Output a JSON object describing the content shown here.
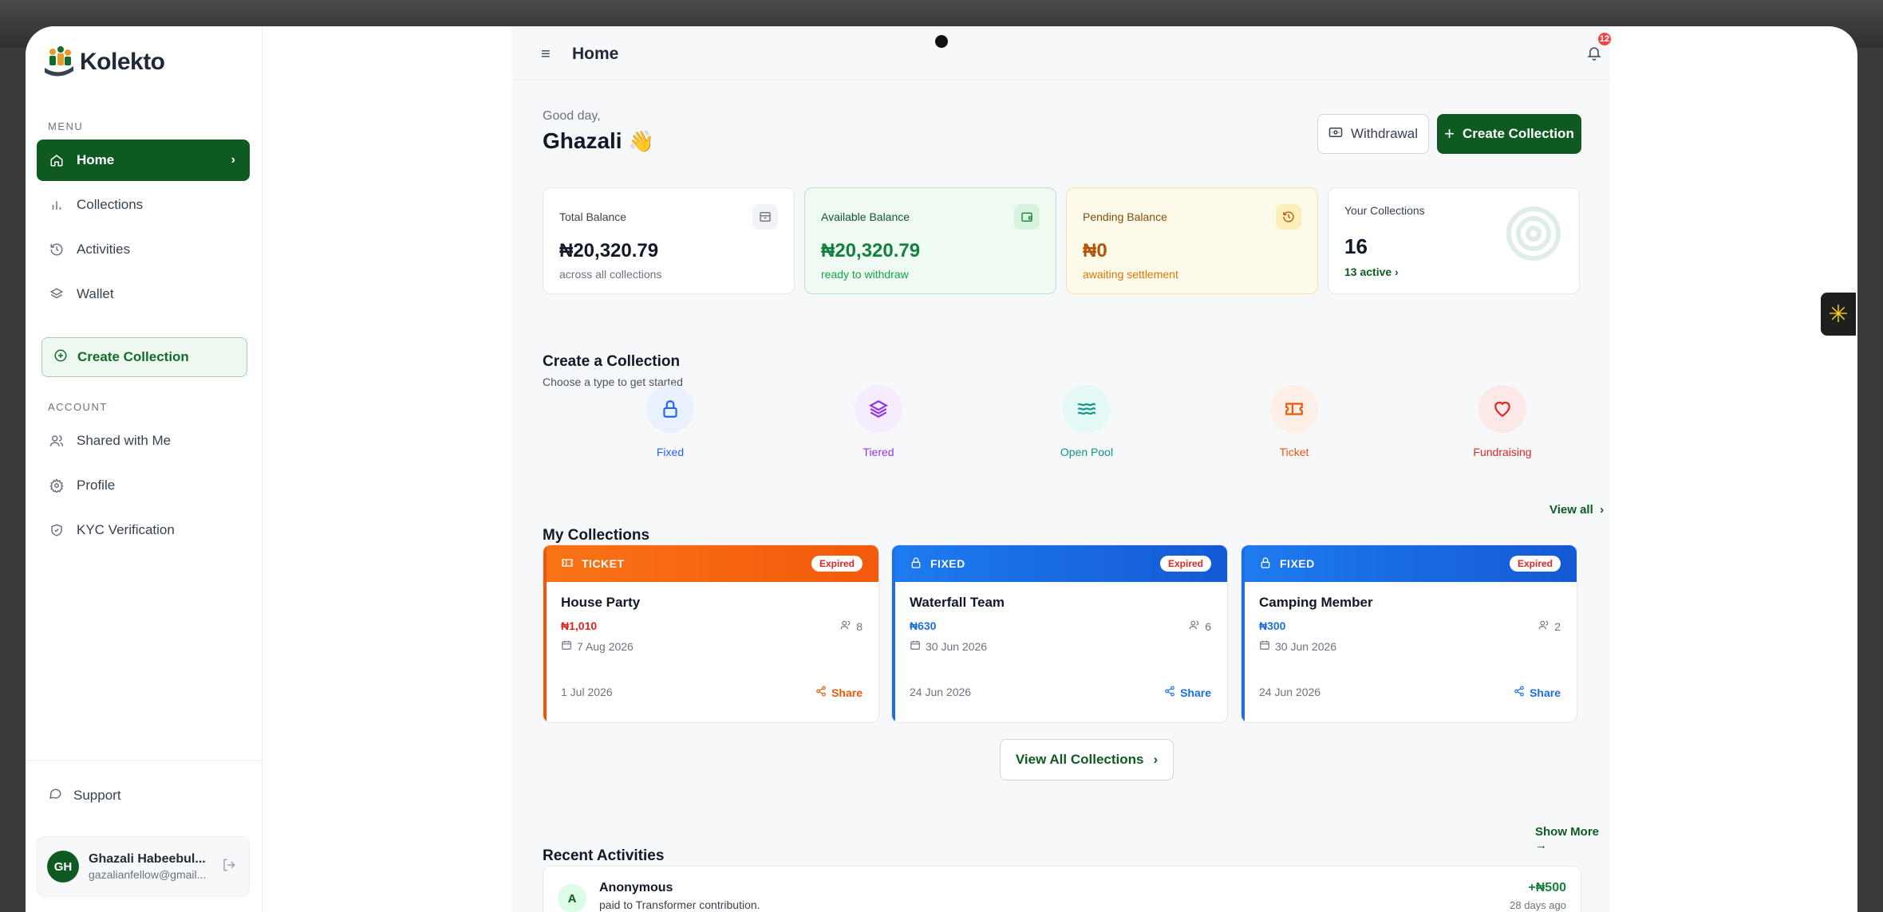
{
  "app": {
    "name": "Kolekto"
  },
  "sidebar": {
    "menu_label": "MENU",
    "account_label": "ACCOUNT",
    "menu_items": [
      {
        "label": "Home",
        "icon": "home-icon"
      },
      {
        "label": "Collections",
        "icon": "bar-chart-icon"
      },
      {
        "label": "Activities",
        "icon": "history-icon"
      },
      {
        "label": "Wallet",
        "icon": "layers-icon"
      }
    ],
    "create_label": "Create Collection",
    "account_items": [
      {
        "label": "Shared with Me",
        "icon": "users-icon"
      },
      {
        "label": "Profile",
        "icon": "gear-icon"
      },
      {
        "label": "KYC Verification",
        "icon": "shield-check-icon"
      }
    ],
    "support_label": "Support",
    "user": {
      "initials": "GH",
      "name": "Ghazali Habeebul...",
      "email": "gazalianfellow@gmail..."
    }
  },
  "topbar": {
    "title": "Home",
    "notification_count": "12"
  },
  "header": {
    "greeting": "Good day,",
    "name": "Ghazali",
    "wave": "👋",
    "withdraw_label": "Withdrawal",
    "create_label": "Create Collection"
  },
  "stats": {
    "total": {
      "label": "Total Balance",
      "value": "₦20,320.79",
      "sub": "across all collections"
    },
    "available": {
      "label": "Available Balance",
      "value": "₦20,320.79",
      "sub": "ready to withdraw"
    },
    "pending": {
      "label": "Pending Balance",
      "value": "₦0",
      "sub": "awaiting settlement"
    },
    "collections": {
      "label": "Your Collections",
      "value": "16",
      "sub": "13 active"
    }
  },
  "create_section": {
    "title": "Create a Collection",
    "subtitle": "Choose a type to get started",
    "types": [
      {
        "label": "Fixed",
        "icon": "lock-icon",
        "color": "#2563eb",
        "bg": "#e8f1fd"
      },
      {
        "label": "Tiered",
        "icon": "layers-icon",
        "color": "#9333ea",
        "bg": "#f5ecfd"
      },
      {
        "label": "Open Pool",
        "icon": "waves-icon",
        "color": "#0d9488",
        "bg": "#e4f8f6"
      },
      {
        "label": "Ticket",
        "icon": "ticket-icon",
        "color": "#ea580c",
        "bg": "#fdefe5"
      },
      {
        "label": "Fundraising",
        "icon": "heart-icon",
        "color": "#dc2626",
        "bg": "#fde8e8"
      }
    ]
  },
  "my_collections": {
    "title": "My Collections",
    "view_all": "View all",
    "items": [
      {
        "type": "TICKET",
        "status": "Expired",
        "title": "House Party",
        "price": "₦1,010",
        "members": "8",
        "date": "7 Aug 2026",
        "created": "1 Jul 2026",
        "share": "Share",
        "color": "#ea580c"
      },
      {
        "type": "FIXED",
        "status": "Expired",
        "title": "Waterfall Team",
        "price": "₦630",
        "members": "6",
        "date": "30 Jun 2026",
        "created": "24 Jun 2026",
        "share": "Share",
        "color": "#1d6fe0"
      },
      {
        "type": "FIXED",
        "status": "Expired",
        "title": "Camping Member",
        "price": "₦300",
        "members": "2",
        "date": "30 Jun 2026",
        "created": "24 Jun 2026",
        "share": "Share",
        "color": "#1d6fe0"
      }
    ],
    "view_all_button": "View All Collections"
  },
  "recent": {
    "title": "Recent Activities",
    "show_more": "Show More →",
    "items": [
      {
        "initial": "A",
        "name": "Anonymous",
        "desc": "paid to Transformer contribution.",
        "amount": "+₦500",
        "time": "28 days ago"
      }
    ]
  }
}
